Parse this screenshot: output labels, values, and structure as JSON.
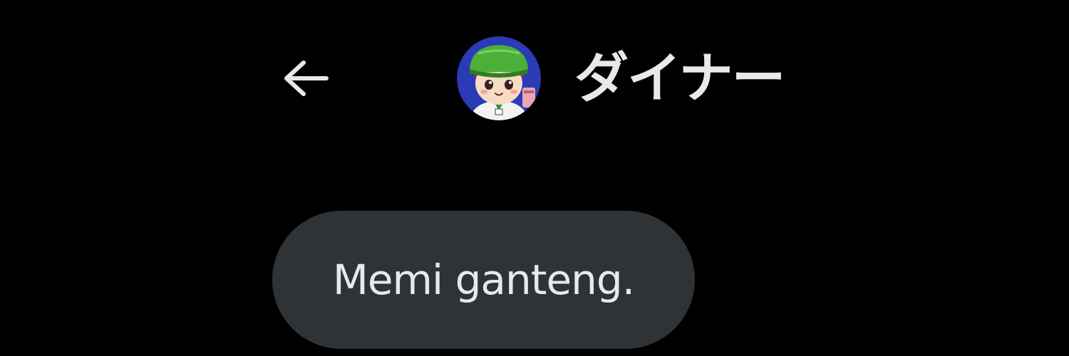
{
  "header": {
    "back_icon": "arrow-left-icon",
    "avatar_icon": "user-avatar-cartoon-green-cap",
    "display_name": "ダイナー"
  },
  "conversation": {
    "messages": [
      {
        "text": "Memi ganteng."
      }
    ]
  },
  "colors": {
    "background": "#000000",
    "text": "#e7e9ea",
    "bubble": "#2f3336"
  }
}
